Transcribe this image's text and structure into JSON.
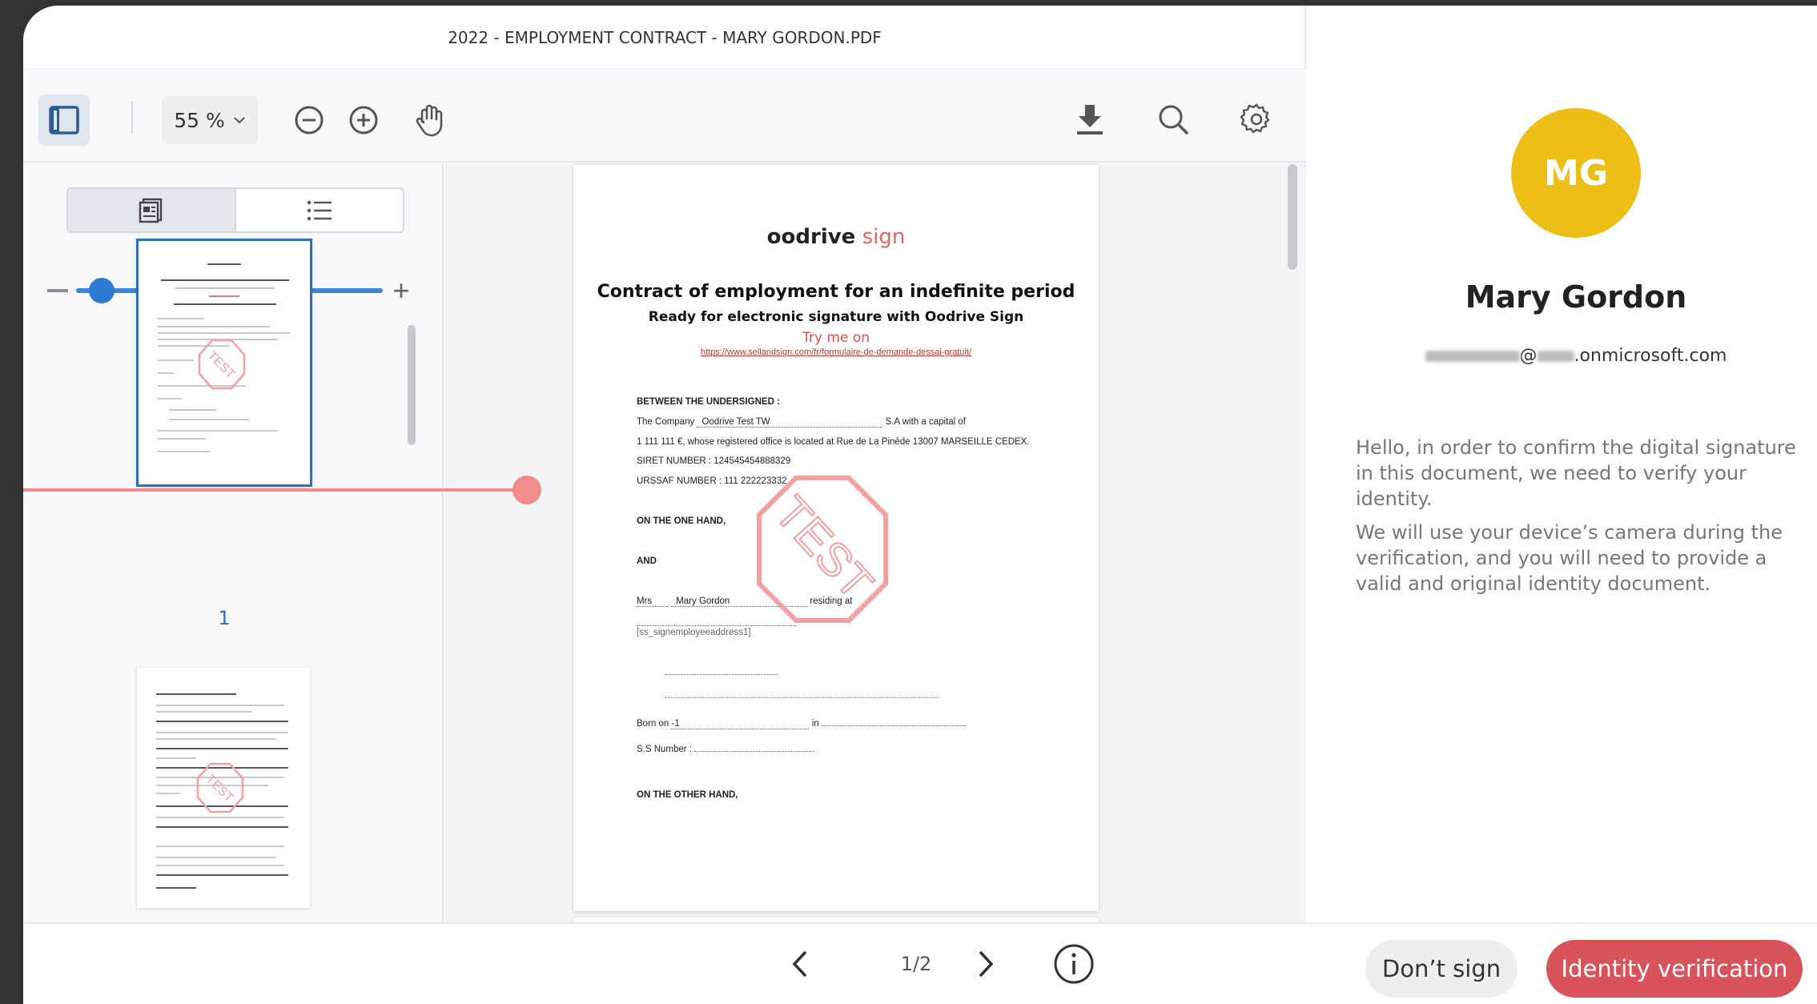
{
  "viewer": {
    "title": "2022 - EMPLOYMENT CONTRACT - MARY GORDON.PDF",
    "zoom_label": "55 %",
    "thumbnail_page_number": "1"
  },
  "document": {
    "logo_main": "oodrive",
    "logo_accent": " sign",
    "title": "Contract of employment for an indefinite period",
    "subtitle": "Ready for electronic signature with Oodrive Sign",
    "try_text": "Try me on",
    "link": "https://www.sellandsign.com/fr/formulaire-de-demande-dessai-gratuit/",
    "between": "BETWEEN THE UNDERSIGNED :",
    "company_prefix": "The Company",
    "company_name": "Oodrive Test TW",
    "company_suffix": "S.A with a capital of",
    "capital_line": "1 111 111 €, whose registered office is located at Rue de La Pinède 13007 MARSEILLE CEDEX.",
    "siret": "SIRET NUMBER : 124545454888329",
    "urssaf": "URSSAF NUMBER : 111 222223332",
    "one_hand": "ON THE ONE HAND,",
    "and": "AND",
    "employee_title": "Mrs",
    "employee_name": "Mary Gordon",
    "residing": "residing at",
    "address_placeholder": "[ss_signemployeeaddress1]",
    "born_on": "Born on",
    "born_value": "-1",
    "born_in": "in",
    "ss_number": "S.S Number :",
    "other_hand": "ON THE OTHER HAND,",
    "stamp_text": "TEST"
  },
  "signer": {
    "initials": "MG",
    "name": "Mary Gordon",
    "email_suffix": ".onmicrosoft.com",
    "email_at": "@",
    "message_1": "Hello, in order to confirm the digital signature in this document, we need to verify your identity.",
    "message_2": "We will use your device’s camera during the verification, and you will need to provide a valid and original identity document."
  },
  "footer": {
    "page_indicator": "1/2",
    "dont_sign_label": "Don’t sign",
    "verify_label": "Identity verification"
  },
  "colors": {
    "avatar": "#ecbe16",
    "accent_red": "#d9545a",
    "accent_blue": "#2e7ad1"
  }
}
